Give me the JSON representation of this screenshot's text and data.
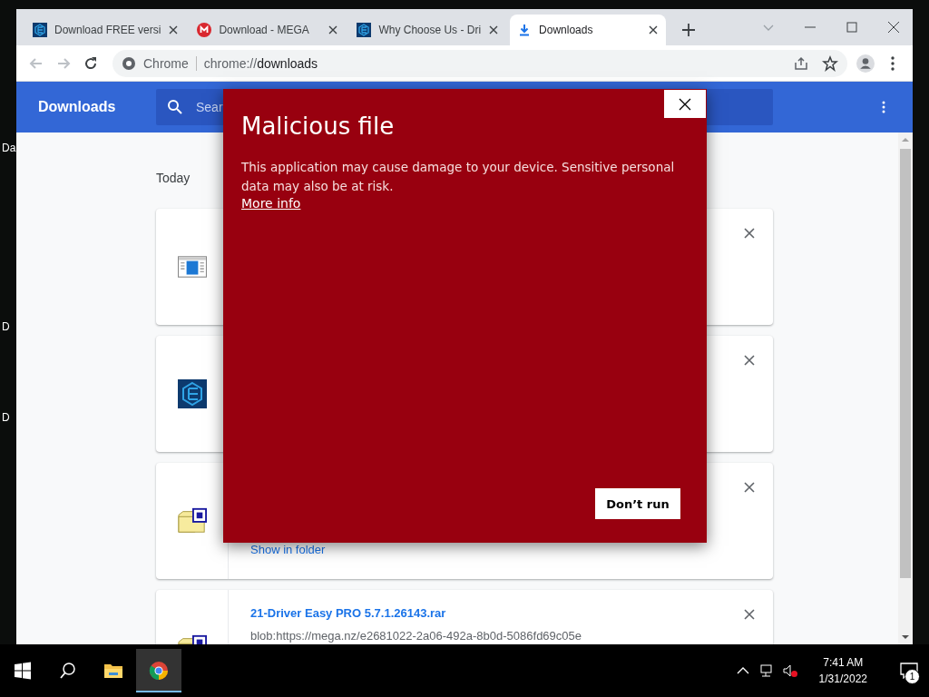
{
  "desktop": {
    "icon_labels": [
      "Da",
      "D",
      "D"
    ]
  },
  "browser": {
    "tabs": [
      {
        "title": "Download FREE versi",
        "kind": "drivereasy",
        "selected": false
      },
      {
        "title": "Download - MEGA",
        "kind": "mega",
        "selected": false
      },
      {
        "title": "Why Choose Us - Dri",
        "kind": "drivereasy",
        "selected": false
      },
      {
        "title": "Downloads",
        "kind": "download",
        "selected": true
      }
    ],
    "address": {
      "chip": "Chrome",
      "url_scheme": "chrome://",
      "url_path": "downloads"
    }
  },
  "page": {
    "title": "Downloads",
    "search": {
      "placeholder": "Sear"
    },
    "section": "Today",
    "items": [
      {
        "kind": "window"
      },
      {
        "kind": "drivereasy"
      },
      {
        "kind": "rar",
        "link": "Show in folder"
      },
      {
        "kind": "rar",
        "name": "21-Driver Easy PRO 5.7.1.26143.rar",
        "url": "blob:https://mega.nz/e2681022-2a06-492a-8b0d-5086fd69c05e"
      }
    ]
  },
  "dialog": {
    "title": "Malicious file",
    "message": "This application may cause damage to your device. Sensitive personal data may also be at risk.",
    "link": "More info",
    "button": "Don’t run"
  },
  "taskbar": {
    "time": "7:41 AM",
    "date": "1/31/2022",
    "notification_count": "1"
  }
}
